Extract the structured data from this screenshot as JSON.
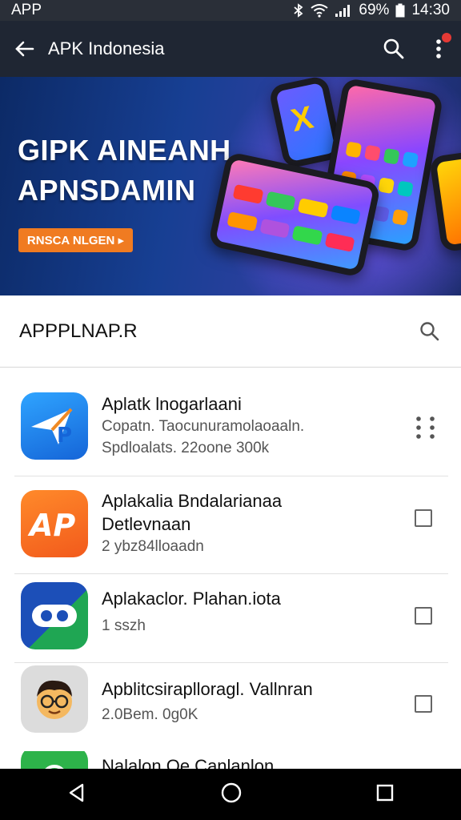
{
  "status_bar": {
    "app_label": "APP",
    "battery": "69%",
    "time": "14:30"
  },
  "app_bar": {
    "title": "APK Indonesia"
  },
  "banner": {
    "line1": "GIPK AINEANH",
    "line2": "APNSDAMIN",
    "cta": "RNSCA NLGEN ▸"
  },
  "section": {
    "title": "APPPLNAP.R"
  },
  "apps": [
    {
      "name": "Aplatk lnogarlaani",
      "line2": "Copatn. Taocunuramolaoaaln.",
      "line3": "Spdloalats. 22oone 300k"
    },
    {
      "name": "Aplakalia Bndalarianaa",
      "line2": "Detlevnaan",
      "line3": "2 ybz84lloaadn"
    },
    {
      "name": "Aplakaclor. Plahan.iota",
      "line2": "1 sszh",
      "line3": ""
    },
    {
      "name": "Apblitcsiraplloragl. Vallnran",
      "line2": "2.0Bem. 0g0K",
      "line3": ""
    },
    {
      "name": "Nalalon Oe Canlanlon",
      "line2": "",
      "line3": ""
    }
  ],
  "colors": {
    "app_bar": "#1f2633",
    "cta": "#f07b21",
    "notification": "#e53935"
  }
}
